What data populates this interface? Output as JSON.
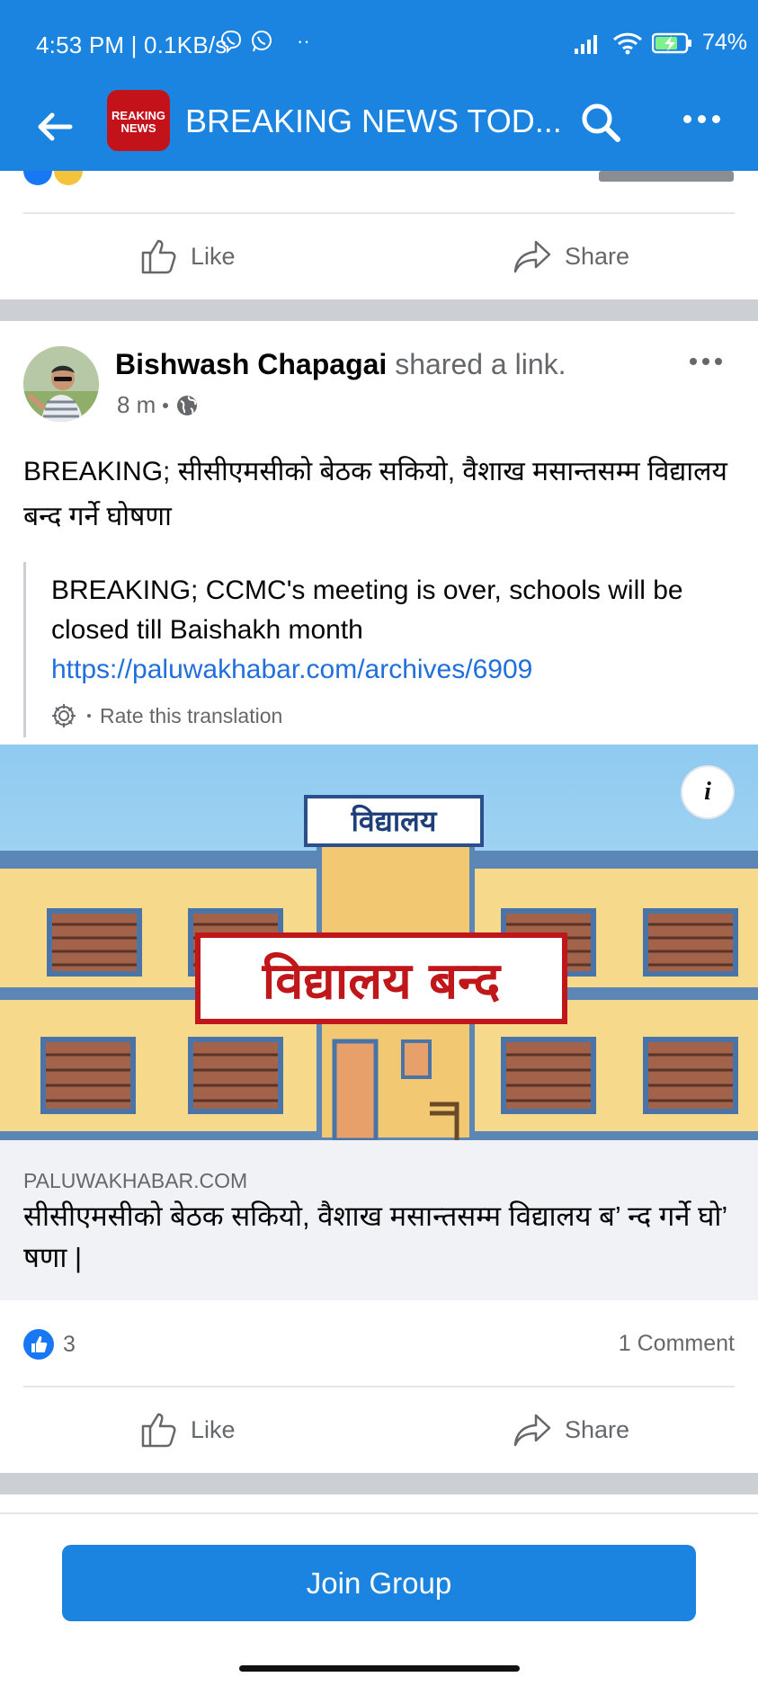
{
  "status_bar": {
    "time_speed": "4:53 PM | 0.1KB/s",
    "dots": "··",
    "battery": "74%"
  },
  "app_bar": {
    "title": "BREAKING NEWS TOD...",
    "group_logo_line1": "REAKING",
    "group_logo_line2": "NEWS"
  },
  "previous_post": {
    "like_label": "Like",
    "share_label": "Share"
  },
  "post": {
    "author": "Bishwash Chapagai",
    "action": "shared a link.",
    "time": "8 m",
    "text": "BREAKING; सीसीएमसीको बेठक सकियो,  वैशाख मसान्तसम्म विद्यालय बन्द गर्ने  घोषणा",
    "translation": {
      "text": "BREAKING; CCMC's meeting is over, schools will be closed till Baishakh month",
      "link": "https://paluwakhabar.com/archives/6909",
      "rate_label": "Rate this translation"
    },
    "illustration": {
      "sign_text": "विद्यालय",
      "banner_text": "विद्यालय बन्द"
    },
    "info_label": "i",
    "link_domain": "PALUWAKHABAR.COM",
    "link_title": "सीसीएमसीको बेठक सकियो, वैशाख मसान्तसम्म विद्यालय ब’ न्द गर्ने घो’ षणा |",
    "reaction_count": "3",
    "comment_count": "1 Comment",
    "like_label": "Like",
    "share_label": "Share"
  },
  "footer": {
    "join_label": "Join Group"
  },
  "colors": {
    "accent": "#1b84e0",
    "link": "#216fdb",
    "secondary_text": "#65676b",
    "divider": "#e4e6eb"
  }
}
